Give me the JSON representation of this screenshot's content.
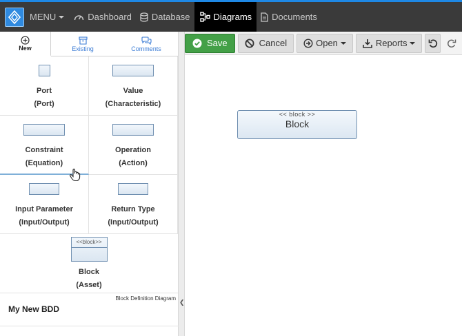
{
  "topbar": {
    "menu_label": "MENU",
    "items": [
      {
        "label": "Dashboard",
        "icon": "dashboard-icon"
      },
      {
        "label": "Database",
        "icon": "database-icon"
      },
      {
        "label": "Diagrams",
        "icon": "diagram-icon",
        "active": true
      },
      {
        "label": "Documents",
        "icon": "document-icon"
      }
    ]
  },
  "left_panel": {
    "tabs": [
      {
        "label": "New",
        "icon": "plus-circle-icon",
        "active": true
      },
      {
        "label": "Existing",
        "icon": "archive-icon"
      },
      {
        "label": "Comments",
        "icon": "comments-icon"
      }
    ],
    "palette": [
      {
        "name": "Port",
        "sub": "(Port)"
      },
      {
        "name": "Value",
        "sub": "(Characteristic)"
      },
      {
        "name": "Constraint",
        "sub": "(Equation)"
      },
      {
        "name": "Operation",
        "sub": "(Action)"
      },
      {
        "name": "Input Parameter",
        "sub": "(Input/Output)"
      },
      {
        "name": "Return Type",
        "sub": "(Input/Output)"
      }
    ],
    "block_item": {
      "stereotype": "<<block>>",
      "name": "Block",
      "sub": "(Asset)"
    },
    "diagram": {
      "type": "Block Definition Diagram",
      "name": "My New BDD"
    }
  },
  "toolbar": {
    "save": "Save",
    "cancel": "Cancel",
    "open": "Open",
    "reports": "Reports"
  },
  "canvas": {
    "block": {
      "stereotype": "<< block >>",
      "name": "Block"
    }
  },
  "colors": {
    "accent": "#1e88e5",
    "save_green": "#43a047",
    "topbar": "#3a3a3a"
  }
}
